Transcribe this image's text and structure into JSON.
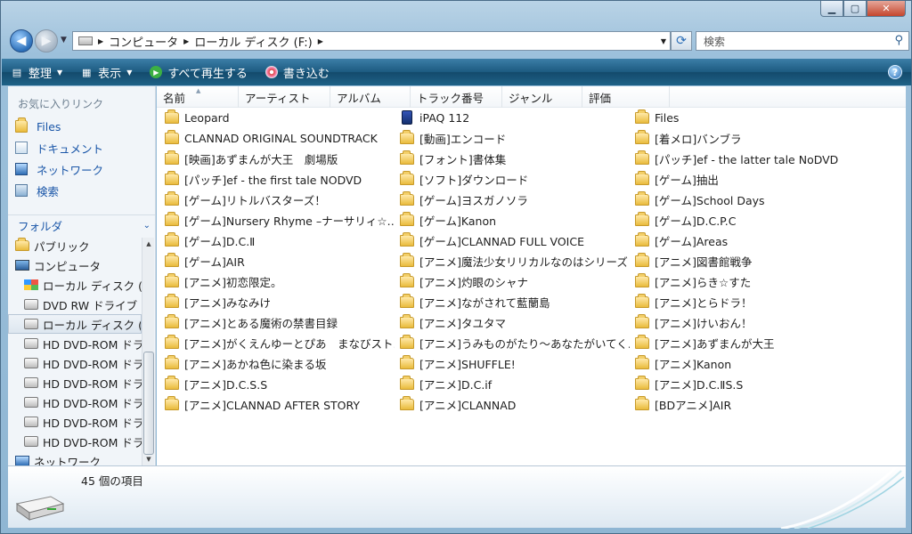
{
  "address": {
    "crumbs": [
      "コンピュータ",
      "ローカル ディスク (F:)"
    ]
  },
  "search": {
    "placeholder": "検索"
  },
  "toolbar": {
    "organize": "整理",
    "view": "表示",
    "play_all": "すべて再生する",
    "burn": "書き込む"
  },
  "nav": {
    "favorites_title": "お気に入りリンク",
    "favorites": [
      "Files",
      "ドキュメント",
      "ネットワーク",
      "検索"
    ],
    "folders_title": "フォルダ",
    "tree": [
      "パブリック",
      "コンピュータ",
      "ローカル ディスク (",
      "DVD RW ドライブ",
      "ローカル ディスク (",
      "HD DVD-ROM ドラ",
      "HD DVD-ROM ドラ",
      "HD DVD-ROM ドラ",
      "HD DVD-ROM ドラ",
      "HD DVD-ROM ドラ",
      "HD DVD-ROM ドラ",
      "ネットワーク"
    ]
  },
  "columns": [
    "名前",
    "アーティスト",
    "アルバム",
    "トラック番号",
    "ジャンル",
    "評価"
  ],
  "items": [
    [
      "Leopard",
      "iPAQ 112",
      "Files"
    ],
    [
      "CLANNAD ORIGINAL SOUNDTRACK",
      "[動画]エンコード",
      "[着メロ]バンブラ"
    ],
    [
      "[映画]あずまんが大王　劇場版",
      "[フォント]書体集",
      "[パッチ]ef - the latter tale NoDVD"
    ],
    [
      "[パッチ]ef - the first tale NODVD",
      "[ソフト]ダウンロード",
      "[ゲーム]抽出"
    ],
    [
      "[ゲーム]リトルバスターズ！",
      "[ゲーム]ヨスガノソラ",
      "[ゲーム]School Days"
    ],
    [
      "[ゲーム]Nursery Rhyme –ナーサリィ☆…",
      "[ゲーム]Kanon",
      "[ゲーム]D.C.P.C"
    ],
    [
      "[ゲーム]D.C.Ⅱ",
      "[ゲーム]CLANNAD FULL VOICE",
      "[ゲーム]Areas"
    ],
    [
      "[ゲーム]AIR",
      "[アニメ]魔法少女リリカルなのはシリーズ",
      "[アニメ]図書館戦争"
    ],
    [
      "[アニメ]初恋限定。",
      "[アニメ]灼眼のシャナ",
      "[アニメ]らき☆すた"
    ],
    [
      "[アニメ]みなみけ",
      "[アニメ]ながされて藍蘭島",
      "[アニメ]とらドラ！"
    ],
    [
      "[アニメ]とある魔術の禁書目録",
      "[アニメ]タユタマ",
      "[アニメ]けいおん！"
    ],
    [
      "[アニメ]がくえんゆーとぴあ　まなびスト…",
      "[アニメ]うみものがたり〜あなたがいてく…",
      "[アニメ]あずまんが大王"
    ],
    [
      "[アニメ]あかね色に染まる坂",
      "[アニメ]SHUFFLE!",
      "[アニメ]Kanon"
    ],
    [
      "[アニメ]D.C.S.S",
      "[アニメ]D.C.if",
      "[アニメ]D.C.ⅡS.S"
    ],
    [
      "[アニメ]CLANNAD AFTER STORY",
      "[アニメ]CLANNAD",
      "[BDアニメ]AIR"
    ]
  ],
  "status": {
    "count": "45 個の項目"
  }
}
